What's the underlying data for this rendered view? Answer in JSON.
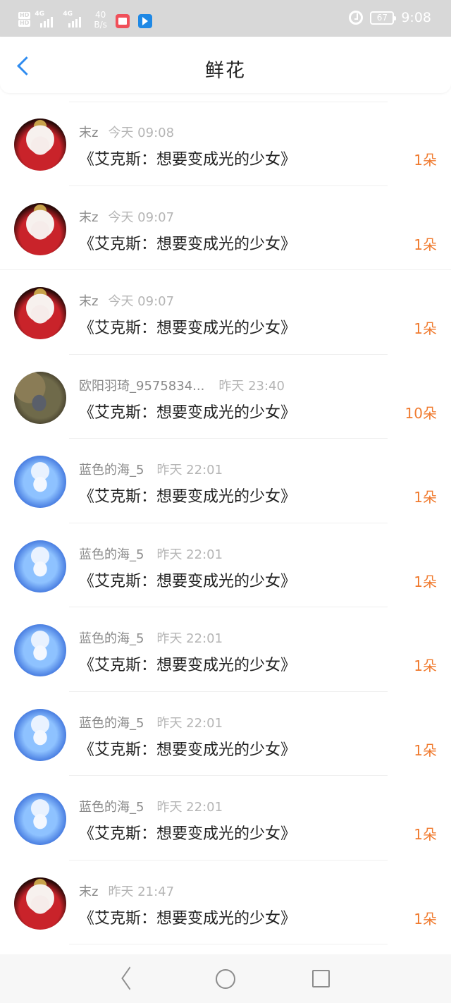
{
  "status_bar": {
    "hd1": "HD",
    "hd2": "HD",
    "net1": "4G",
    "net2": "4G",
    "speed_value": "40",
    "speed_unit": "B/s",
    "battery": "67",
    "time": "9:08"
  },
  "header": {
    "title": "鲜花"
  },
  "items": [
    {
      "user": "末z",
      "time": "今天 09:08",
      "work": "《艾克斯：想要变成光的少女》",
      "amount": "1朵",
      "avatar": "crown"
    },
    {
      "user": "末z",
      "time": "今天 09:07",
      "work": "《艾克斯：想要变成光的少女》",
      "amount": "1朵",
      "avatar": "crown"
    },
    {
      "user": "末z",
      "time": "今天 09:07",
      "work": "《艾克斯：想要变成光的少女》",
      "amount": "1朵",
      "avatar": "crown"
    },
    {
      "user": "欧阳羽琦_9575834...",
      "time": "昨天 23:40",
      "work": "《艾克斯：想要变成光的少女》",
      "amount": "10朵",
      "avatar": "forest"
    },
    {
      "user": "蓝色的海_5",
      "time": "昨天 22:01",
      "work": "《艾克斯：想要变成光的少女》",
      "amount": "1朵",
      "avatar": "ice"
    },
    {
      "user": "蓝色的海_5",
      "time": "昨天 22:01",
      "work": "《艾克斯：想要变成光的少女》",
      "amount": "1朵",
      "avatar": "ice"
    },
    {
      "user": "蓝色的海_5",
      "time": "昨天 22:01",
      "work": "《艾克斯：想要变成光的少女》",
      "amount": "1朵",
      "avatar": "ice"
    },
    {
      "user": "蓝色的海_5",
      "time": "昨天 22:01",
      "work": "《艾克斯：想要变成光的少女》",
      "amount": "1朵",
      "avatar": "ice"
    },
    {
      "user": "蓝色的海_5",
      "time": "昨天 22:01",
      "work": "《艾克斯：想要变成光的少女》",
      "amount": "1朵",
      "avatar": "ice"
    },
    {
      "user": "末z",
      "time": "昨天 21:47",
      "work": "《艾克斯：想要变成光的少女》",
      "amount": "1朵",
      "avatar": "crown"
    }
  ],
  "colors": {
    "accent": "#2f8cf0",
    "amount": "#f07a2e",
    "status_bar": "#d8d8d8"
  },
  "icons": {
    "back": "chevron-left-icon",
    "alarm": "alarm-clock-icon",
    "nav_back": "triangle-back-icon",
    "nav_home": "circle-home-icon",
    "nav_recent": "square-recents-icon"
  }
}
